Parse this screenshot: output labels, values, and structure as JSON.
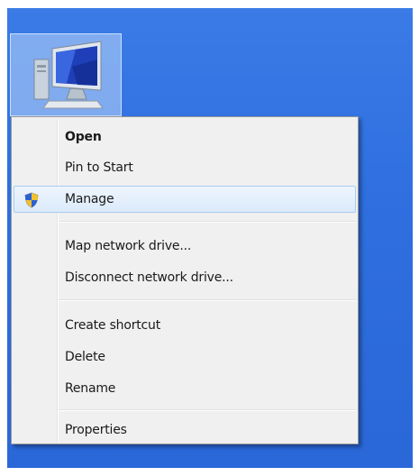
{
  "desktop": {
    "icon": "computer-icon"
  },
  "context_menu": {
    "items": [
      {
        "label": "Open",
        "bold": true
      },
      {
        "label": "Pin to Start"
      },
      {
        "label": "Manage",
        "icon": "shield-icon",
        "highlighted": true
      },
      {
        "label": "Map network drive..."
      },
      {
        "label": "Disconnect network drive..."
      },
      {
        "label": "Create shortcut"
      },
      {
        "label": "Delete"
      },
      {
        "label": "Rename"
      },
      {
        "label": "Properties"
      }
    ]
  },
  "colors": {
    "desktop_background": "#2f6fe0",
    "menu_background": "#f0f0f0",
    "highlight_border": "#a8cdf2",
    "highlight_fill": "#dbeafc"
  }
}
